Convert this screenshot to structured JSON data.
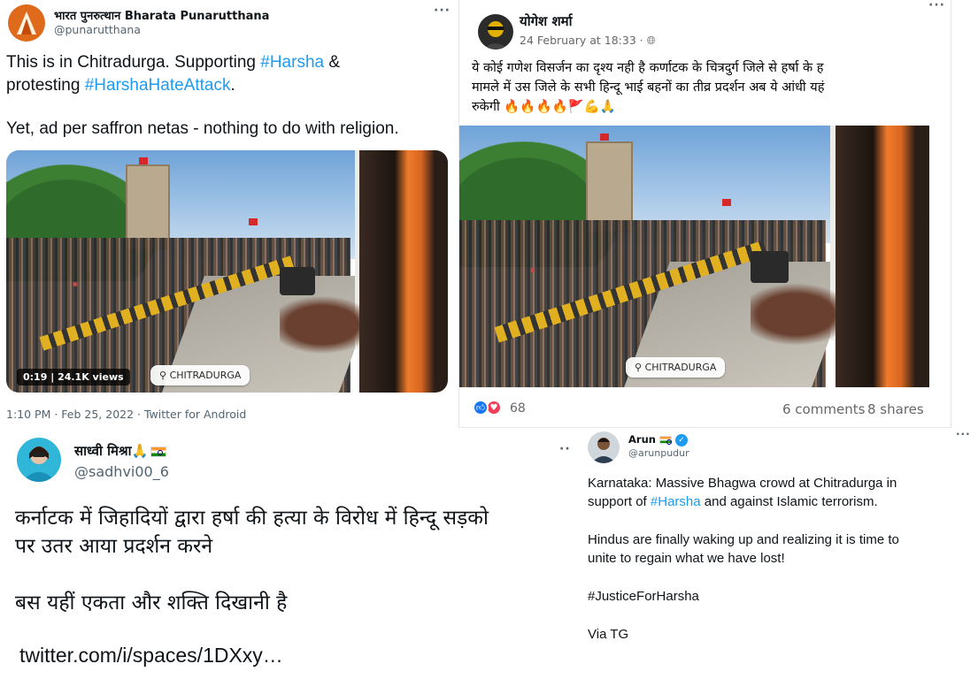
{
  "tweet1": {
    "name": "भारत पुनरुत्थान Bharata Punarutthana",
    "handle": "@punarutthana",
    "more": "···",
    "text": {
      "l1_pre": "This is in Chitradurga. Supporting ",
      "l1_tag": "#Harsha",
      "l1_post": " &",
      "l2_pre": "protesting ",
      "l2_tag": "#HarshaHateAttack",
      "l2_post": ".",
      "l3": "Yet, ad per saffron netas - nothing to do with religion."
    },
    "video": {
      "duration": "0:19",
      "views": "24.1K views",
      "location": "CHITRADURGA"
    },
    "footer": "1:10 PM · Feb 25, 2022 · Twitter for Android"
  },
  "fbpost": {
    "name": "योगेश शर्मा",
    "date": "24 February at 18:33 · ",
    "more": "···",
    "text": {
      "l1": "ये कोई गणेश विसर्जन का दृश्य नही है कर्णाटक के चित्रदुर्ग जिले से हर्षा के ह",
      "l2": "मामले में उस जिले के सभी हिन्दू भाई बहनों का तीव्र प्रदर्शन अब ये आंधी यहं",
      "l3": "रुकेगी 🔥🔥🔥🔥🚩💪🙏"
    },
    "video": {
      "location": "CHITRADURGA"
    },
    "reactions_count": "68",
    "comments": "6 comments",
    "shares": "8 shares"
  },
  "tweet3": {
    "name": "साध्वी मिश्रा🙏",
    "handle": "@sadhvi00_6",
    "more": "··",
    "text": {
      "l1": "कर्नाटक में जिहादियों द्वारा हर्षा की हत्या के विरोध में हिन्दू सड़को",
      "l2": "पर उतर आया प्रदर्शन करने",
      "l3": "बस यहीं एकता और शक्ति दिखानी है"
    },
    "link": "twitter.com/i/spaces/1DXxy…"
  },
  "tweet4": {
    "name": "Arun",
    "handle": "@arunpudur",
    "more": "···",
    "text": {
      "l1": "Karnataka: Massive Bhagwa crowd at Chitradurga in",
      "l2_pre": "support of ",
      "l2_tag": "#Harsha",
      "l2_post": " and against Islamic terrorism.",
      "l3": "Hindus are finally waking up and realizing it is time to",
      "l4": "unite to regain what we have lost!",
      "l5": "#JusticeForHarsha",
      "l6": "Via TG"
    }
  },
  "colors": {
    "link": "#1d9bf0",
    "saffron": "#e8731c",
    "fb_like": "#1877f2",
    "fb_love": "#f33e58"
  },
  "icons": [
    "globe-icon",
    "location-pin-icon",
    "verified-badge-icon",
    "india-flag-icon",
    "like-reaction-icon",
    "love-reaction-icon"
  ]
}
